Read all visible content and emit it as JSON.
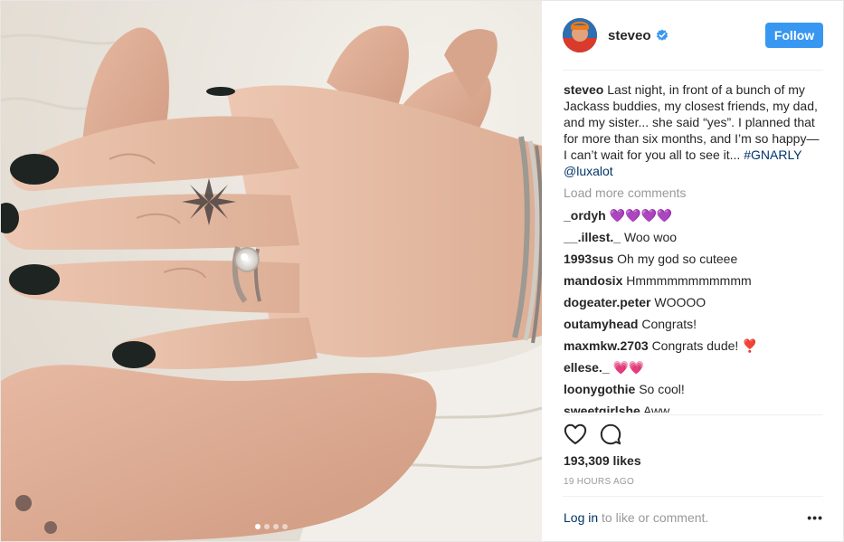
{
  "post": {
    "username": "steveo",
    "follow_label": "Follow",
    "caption": {
      "username": "steveo",
      "text": "Last night, in front of a bunch of my Jackass buddies, my closest friends, my dad, and my sister... she said “yes”. I planned that for more than six months, and I’m so happy— I can’t wait for you all to see it...",
      "hashtag": "#GNARLY",
      "mention": "@luxalot"
    },
    "load_more_label": "Load more comments",
    "comments": [
      {
        "user": "_ordyh",
        "text": "💜💜💜💜"
      },
      {
        "user": "__.illest._",
        "text": "Woo woo"
      },
      {
        "user": "1993sus",
        "text": "Oh my god so cuteee"
      },
      {
        "user": "mandosix",
        "text": "Hmmmmmmmmmmm"
      },
      {
        "user": "dogeater.peter",
        "text": "WOOOO"
      },
      {
        "user": "outamyhead",
        "text": "Congrats!"
      },
      {
        "user": "maxmkw.2703",
        "text": "Congrats dude! ❣️"
      },
      {
        "user": "ellese._",
        "text": "💗💗"
      },
      {
        "user": "loonygothie",
        "text": "So cool!"
      },
      {
        "user": "sweetgirlshe",
        "text": "Aww"
      }
    ],
    "likes": "193,309 likes",
    "time": "19 HOURS AGO",
    "footer": {
      "login_label": "Log in",
      "login_suffix": "to like or comment.",
      "more_label": "•••"
    },
    "carousel": {
      "count": 4,
      "active": 1
    }
  },
  "colors": {
    "accent": "#3897f0",
    "link": "#003569",
    "muted": "#999999",
    "text": "#262626",
    "verified": "#3897f0",
    "nail_polish": "#1d2421"
  },
  "icons": {
    "like": "heart-outline-icon",
    "comment": "speech-bubble-icon",
    "verified": "verified-badge-icon",
    "options": "ellipsis-icon"
  }
}
